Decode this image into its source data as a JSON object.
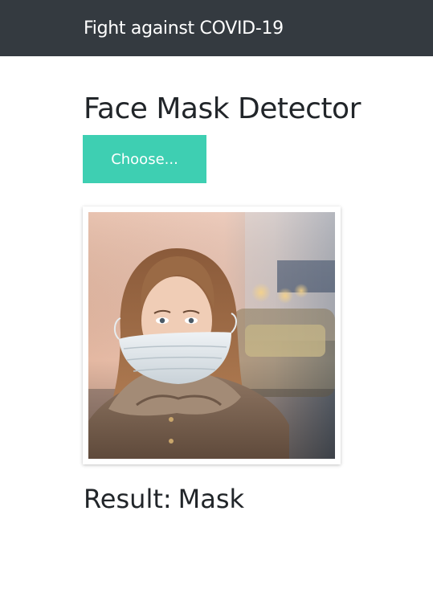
{
  "navbar": {
    "brand": "Fight against COVID-19"
  },
  "main": {
    "title": "Face Mask Detector",
    "choose_label": "Choose...",
    "preview_icon": "uploaded-face-photo",
    "result_label": "Result:",
    "result_value": "Mask"
  },
  "colors": {
    "navbar_bg": "#343a40",
    "accent": "#3ecfb2"
  }
}
